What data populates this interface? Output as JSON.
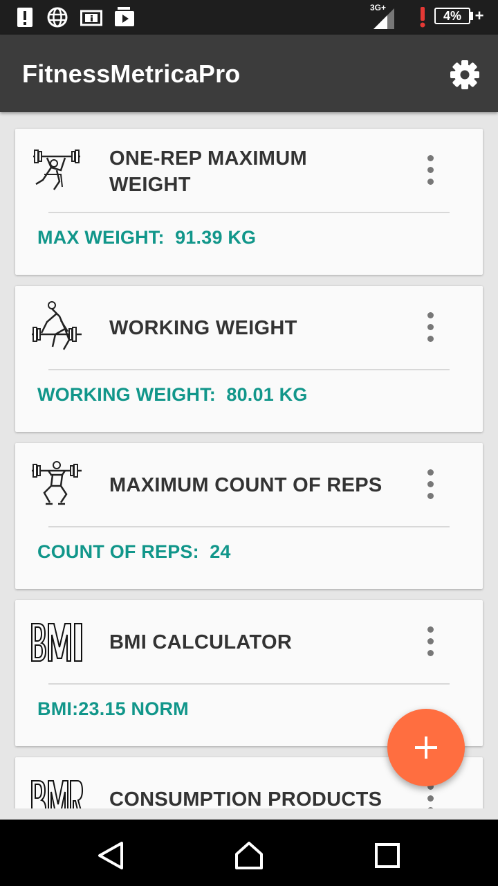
{
  "status_bar": {
    "network_type": "3G+",
    "battery_percent": "4%",
    "charging_symbol": "+",
    "icons": [
      "alert-icon",
      "globe-icon",
      "info-card-icon",
      "media-icon",
      "signal-icon",
      "warning-icon",
      "battery-icon"
    ]
  },
  "app_bar": {
    "title": "FitnessMetricaPro",
    "settings_icon": "gear-icon"
  },
  "colors": {
    "app_bar": "#3c3c3c",
    "accent_text": "#11968a",
    "fab": "#ff6e40",
    "background": "#e6e6e6"
  },
  "cards": [
    {
      "icon": "bench-press-icon",
      "title": "ONE-REP MAXIMUM WEIGHT",
      "value": "MAX WEIGHT:  91.39 KG"
    },
    {
      "icon": "deadlift-icon",
      "title": "WORKING WEIGHT",
      "value": "WORKING WEIGHT:  80.01 KG"
    },
    {
      "icon": "squat-icon",
      "title": "MAXIMUM COUNT OF REPS",
      "value": "COUNT OF REPS:  24"
    },
    {
      "icon": "bmi-logo-icon",
      "logo_text": "BMI",
      "title": "BMI CALCULATOR",
      "value": "BMI:23.15 NORM"
    },
    {
      "icon": "bmr-logo-icon",
      "logo_text": "BMR",
      "title": "CONSUMPTION PRODUCTS",
      "value": ""
    }
  ],
  "fab": {
    "label": "+",
    "icon": "add-icon"
  },
  "nav_bar": {
    "icons": [
      "back-icon",
      "home-icon",
      "recents-icon"
    ]
  }
}
